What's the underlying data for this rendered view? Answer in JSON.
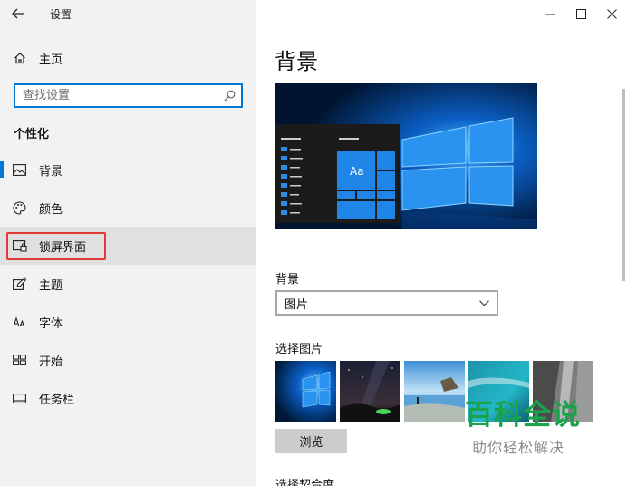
{
  "app": {
    "title": "设置"
  },
  "sidebar": {
    "home_label": "主页",
    "search_placeholder": "查找设置",
    "section_title": "个性化",
    "items": [
      {
        "label": "背景",
        "icon": "picture-icon",
        "selected": true
      },
      {
        "label": "颜色",
        "icon": "palette-icon"
      },
      {
        "label": "锁屏界面",
        "icon": "lock-screen-icon",
        "hovered": true,
        "highlighted": true
      },
      {
        "label": "主题",
        "icon": "theme-icon"
      },
      {
        "label": "字体",
        "icon": "font-icon"
      },
      {
        "label": "开始",
        "icon": "start-icon"
      },
      {
        "label": "任务栏",
        "icon": "taskbar-icon"
      }
    ]
  },
  "main": {
    "page_title": "背景",
    "background_label": "背景",
    "background_value": "图片",
    "choose_picture_label": "选择图片",
    "browse_label": "浏览",
    "fit_label": "选择契合度",
    "preview_tile_text": "Aa"
  },
  "watermark": {
    "main": "百科全说",
    "sub": "助你轻松解决"
  },
  "colors": {
    "accent": "#0078d7",
    "highlight_border": "#e53935",
    "watermark_green": "#1aa34a"
  }
}
